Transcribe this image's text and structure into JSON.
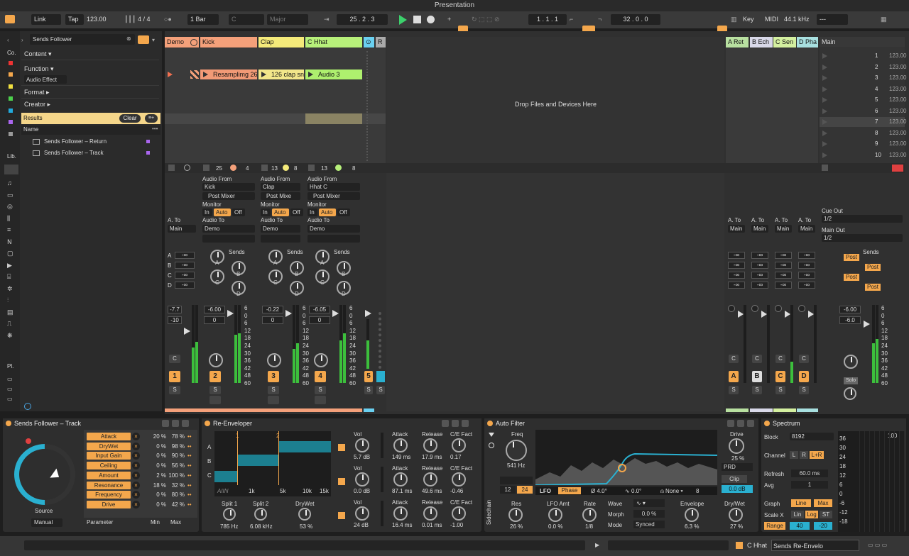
{
  "app": {
    "title": "Presentation"
  },
  "toolbar": {
    "link": "Link",
    "tap": "Tap",
    "tempo": "123.00",
    "time_sig": "4 / 4",
    "quant": "1 Bar",
    "key": "C",
    "scale": "Major",
    "arrangement_pos": "25 .  2 .  3",
    "loop_start": "1 .  1 .  1",
    "loop_len": "32 .  0 .  0",
    "key_label": "Key",
    "midi_label": "MIDI",
    "sample_rate": "44.1 kHz",
    "cpu": "---"
  },
  "browser": {
    "search": "Sends Follower",
    "collections_label": "Co.",
    "library_label": "Lib.",
    "places_label": "Pl.",
    "filters": [
      {
        "label": "Content ▾"
      },
      {
        "label": "Function ▾"
      },
      {
        "label": "Audio Effect"
      },
      {
        "label": "Format ▸"
      },
      {
        "label": "Creator ▸"
      }
    ],
    "results_label": "Results",
    "clear_label": "Clear",
    "name_header": "Name",
    "items": [
      {
        "label": "Sends Follower – Return"
      },
      {
        "label": "Sends Follower – Track"
      }
    ]
  },
  "session": {
    "drop_hint": "Drop Files and Devices Here",
    "tracks": [
      {
        "name": "Demo",
        "color": "#f4a07a",
        "number": "1"
      },
      {
        "name": "Kick",
        "color": "#f4a07a",
        "number": "2",
        "clip": "Resamplimg 26",
        "clip_color": "#f29a76",
        "count_a": "25",
        "count_b": "4",
        "audio_from": "Kick",
        "mixer": "Post Mixer",
        "audio_to": "Demo",
        "vol": "-6.00",
        "pan": "0"
      },
      {
        "name": "Clap",
        "color": "#f4ea7a",
        "number": "3",
        "clip": "126 clap sn",
        "clip_color": "#f2e68a",
        "count_a": "13",
        "count_b": "8",
        "audio_from": "Clap",
        "mixer": "Post Mixe",
        "audio_to": "Demo",
        "vol": "-0.22",
        "pan": "0"
      },
      {
        "name": "C Hhat",
        "color": "#b7f07a",
        "number": "4",
        "clip": "Audio 3",
        "clip_color": "#aef06e",
        "count_a": "13",
        "count_b": "8",
        "audio_from": "Hhat C",
        "mixer": "Post Mixer",
        "audio_to": "Demo",
        "vol": "-6.05",
        "pan": "0"
      }
    ],
    "demo_vol": "-7.7",
    "demo_pan": "-10",
    "demo_audio_to": "Main",
    "group_track": {
      "number": "5"
    },
    "returns": [
      {
        "name": "A Ret",
        "color": "#b8e0a0",
        "letter": "A"
      },
      {
        "name": "B Ech",
        "color": "#d8d8e8",
        "letter": "B"
      },
      {
        "name": "C Sen",
        "color": "#d4f0a0",
        "letter": "C"
      },
      {
        "name": "D Pha",
        "color": "#a8e0e0",
        "letter": "D"
      }
    ],
    "main": {
      "name": "Main",
      "scenes": [
        "1",
        "2",
        "3",
        "4",
        "5",
        "6",
        "7",
        "8",
        "9",
        "10"
      ],
      "tempo": "123.00",
      "cue_out_label": "Cue Out",
      "cue_out": "1/2",
      "main_out_label": "Main Out",
      "main_out": "1/2",
      "vol": "-6.00",
      "pan": "-6.0",
      "solo": "Solo",
      "post": "Post"
    },
    "labels": {
      "audio_from": "Audio From",
      "monitor": "Monitor",
      "in": "In",
      "auto": "Auto",
      "off": "Off",
      "audio_to": "Audio To",
      "a_to": "A. To",
      "sends": "Sends",
      "inf": "-∞",
      "db_scale": [
        "6",
        "0",
        "6",
        "12",
        "18",
        "24",
        "30",
        "36",
        "42",
        "48",
        "60"
      ],
      "c": "C",
      "s": "S"
    }
  },
  "devices": {
    "sends_follower": {
      "title": "Sends Follower – Track",
      "source_label": "Source",
      "source": "Manual",
      "param_header": "Parameter",
      "min_header": "Min",
      "max_header": "Max",
      "params": [
        {
          "name": "Attack",
          "min": "20 %",
          "max": "78 %"
        },
        {
          "name": "DryWet",
          "min": "0 %",
          "max": "98 %"
        },
        {
          "name": "Input Gain",
          "min": "0 %",
          "max": "90 %"
        },
        {
          "name": "Ceiling",
          "min": "0 %",
          "max": "56 %"
        },
        {
          "name": "Amount",
          "min": "2 %",
          "max": "100 %"
        },
        {
          "name": "Resonance",
          "min": "18 %",
          "max": "32 %"
        },
        {
          "name": "Frequency",
          "min": "0 %",
          "max": "80 %"
        },
        {
          "name": "Drive",
          "min": "0 %",
          "max": "42 %"
        }
      ]
    },
    "re_enveloper": {
      "title": "Re-Enveloper",
      "band_labels": [
        "A",
        "B",
        "C"
      ],
      "markers": [
        "1",
        "2"
      ],
      "freq_ticks": [
        "1k",
        "5k",
        "10k",
        "15k"
      ],
      "logo": "AIIN",
      "split1_label": "Split 1",
      "split1": "785 Hz",
      "split2_label": "Split 2",
      "split2": "6.08 kHz",
      "drywet_label": "DryWet",
      "drywet": "53 %",
      "bands": [
        {
          "vol": "5.7 dB",
          "attack": "149 ms",
          "release": "17.9 ms",
          "ce": "0.17"
        },
        {
          "vol": "0.0 dB",
          "attack": "87.1 ms",
          "release": "49.6 ms",
          "ce": "-0.46"
        },
        {
          "vol": "24 dB",
          "attack": "16.4 ms",
          "release": "0.01 ms",
          "ce": "-1.00"
        }
      ],
      "col_labels": {
        "vol": "Vol",
        "attack": "Attack",
        "release": "Release",
        "ce": "C/E Fact"
      }
    },
    "auto_filter": {
      "title": "Auto Filter",
      "freq_label": "Freq",
      "freq": "541 Hz",
      "res_label": "Res",
      "res": "26 %",
      "drive_label": "Drive",
      "drive": "25 %",
      "mode": "PRD",
      "clip": "Clip",
      "out": "0.0 dB",
      "slope_a": "12",
      "slope_b": "24",
      "lfo": "LFO",
      "phase": "Phase",
      "phase_val": "4.0°",
      "offset": "0.0°",
      "none": "None",
      "none_val": "8",
      "lfo_amt_label": "LFO Amt",
      "lfo_amt": "0.0 %",
      "rate_label": "Rate",
      "rate": "1/8",
      "wave_label": "Wave",
      "morph_label": "Morph",
      "morph": "0.0 %",
      "mode_label": "Mode",
      "mode_val": "Synced",
      "env_label": "Envelope",
      "env": "6.3 %",
      "drywet_label": "Dry/Wet",
      "drywet": "27 %",
      "sidechain": "Sidechain"
    },
    "spectrum": {
      "title": "Spectrum",
      "block_label": "Block",
      "block": "8192",
      "channel_label": "Channel",
      "ch_l": "L",
      "ch_r": "R",
      "ch_lr": "L+R",
      "refresh_label": "Refresh",
      "refresh": "60.0 ms",
      "avg_label": "Avg",
      "avg": "1",
      "graph_label": "Graph",
      "graph_line": "Line",
      "graph_max": "Max",
      "scale_label": "Scale X",
      "scale_lin": "Lin",
      "scale_log": "Log",
      "scale_st": "ST",
      "range_label": "Range",
      "range_a": "40",
      "range_b": "-20",
      "db_ticks": [
        "36",
        "30",
        "24",
        "18",
        "12",
        "6",
        "0",
        "-6",
        "-12",
        "-18"
      ],
      "top_tick": "100"
    }
  },
  "status": {
    "track": "C Hhat",
    "device": "Sends Re-Envelo"
  }
}
